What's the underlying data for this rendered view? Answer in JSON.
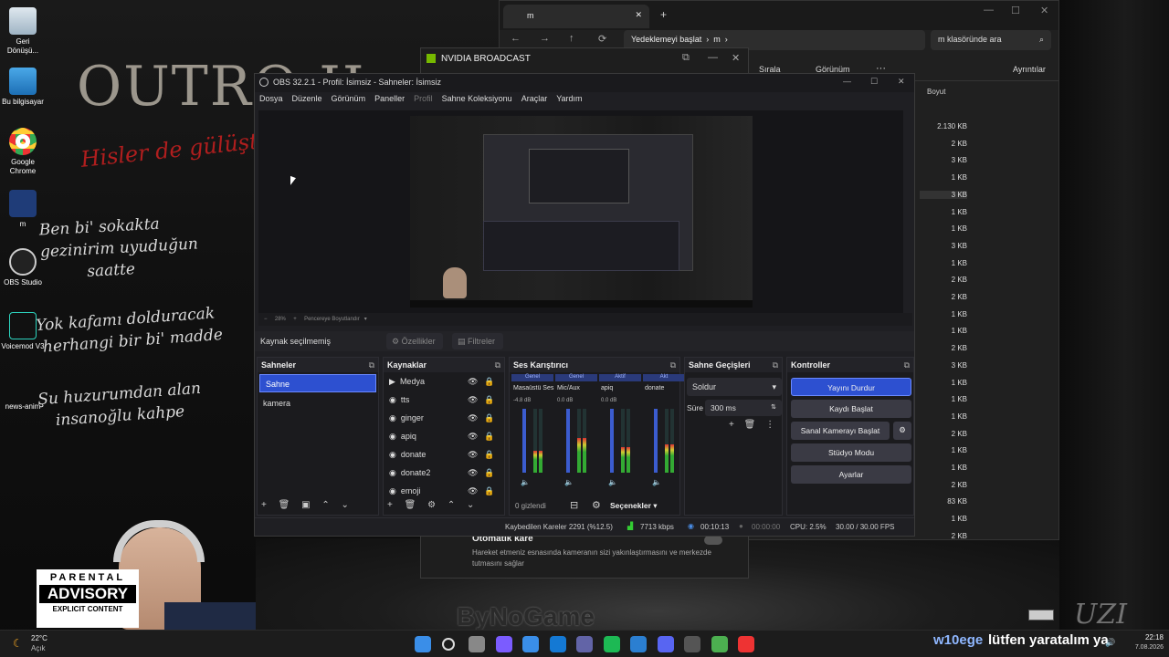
{
  "desktop": {
    "icons": [
      {
        "label": "Geri Dönüşü...",
        "icon": "recycle-bin-icon"
      },
      {
        "label": "Bu bilgisayar",
        "icon": "computer-icon"
      },
      {
        "label": "Google Chrome",
        "icon": "chrome-icon"
      },
      {
        "label": "m",
        "icon": "folder-icon"
      },
      {
        "label": "OBS Studio",
        "icon": "obs-icon"
      },
      {
        "label": "Voicemod V3",
        "icon": "voicemod-icon"
      },
      {
        "label": "news-anim",
        "icon": "file-icon"
      }
    ],
    "wallpaper_title": "OUTRO II",
    "wallpaper_red": "Hisler de gülüşte",
    "lyrics": [
      "Ben bi' sokakta",
      "gezinirim uyuduğun",
      "saatte",
      "Yok kafamı dolduracak",
      "herhangi bir bi' madde",
      "Şu huzurumdan alan",
      "insanoğlu kahpe"
    ],
    "advisory": [
      "PARENTAL",
      "ADVISORY",
      "EXPLICIT CONTENT"
    ],
    "signature": "UZI"
  },
  "explorer": {
    "tab": "m",
    "breadcrumb": [
      "Yedeklemeyi başlat",
      "m"
    ],
    "search_placeholder": "m klasöründe ara",
    "toolbar": [
      "Sırala",
      "Görünüm",
      "Ayrıntılar"
    ],
    "size_header": "Boyut",
    "sizes": [
      "2.130 KB",
      "2 KB",
      "3 KB",
      "1 KB",
      "3 KB",
      "1 KB",
      "1 KB",
      "3 KB",
      "1 KB",
      "2 KB",
      "2 KB",
      "1 KB",
      "1 KB",
      "2 KB",
      "3 KB",
      "1 KB",
      "1 KB",
      "1 KB",
      "2 KB",
      "1 KB",
      "1 KB",
      "2 KB",
      "83 KB",
      "1 KB",
      "2 KB"
    ]
  },
  "nvidia": {
    "title": "NVIDIA BROADCAST",
    "auto_frame_title": "Otomatik kare",
    "auto_frame_desc": "Hareket etmeniz esnasında kameranın sizi yakınlaştırmasını ve merkezde tutmasını sağlar"
  },
  "obs": {
    "title": "OBS 32.2.1 - Profil: İsimsiz - Sahneler: İsimsiz",
    "menu": [
      "Dosya",
      "Düzenle",
      "Görünüm",
      "Paneller",
      "Profil",
      "Sahne Koleksiyonu",
      "Araçlar",
      "Yardım"
    ],
    "zoom": "28%",
    "fit_label": "Pencereye Boyutlandır",
    "no_source": "Kaynak seçilmemiş",
    "properties": "Özellikler",
    "filters": "Filtreler",
    "scenes": {
      "title": "Sahneler",
      "items": [
        "Sahne",
        "kamera"
      ],
      "selected": 0
    },
    "sources": {
      "title": "Kaynaklar",
      "items": [
        "Medya",
        "tts",
        "ginger",
        "apiq",
        "donate",
        "donate2",
        "emoji"
      ]
    },
    "mixer": {
      "title": "Ses Karıştırıcı",
      "channels": [
        {
          "label": "Genel",
          "name": "Masaüstü Ses",
          "db": "-4.8 dB",
          "level": 0.35
        },
        {
          "label": "Genel",
          "name": "Mic/Aux",
          "db": "0.0 dB",
          "level": 0.55
        },
        {
          "label": "Aktif",
          "name": "apiq",
          "db": "0.0 dB",
          "level": 0.4
        },
        {
          "label": "Akt",
          "name": "donate",
          "db": "",
          "level": 0.45
        }
      ],
      "scale": [
        "0",
        "-6",
        "-12",
        "-18",
        "-24",
        "-30",
        "-36",
        "-42",
        "-48",
        "-54",
        "-60"
      ],
      "hidden": "0 gizlendi",
      "options": "Seçenekler"
    },
    "transitions": {
      "title": "Sahne Geçişleri",
      "type": "Soldur",
      "duration_label": "Süre",
      "duration": "300 ms"
    },
    "controls": {
      "title": "Kontroller",
      "buttons": [
        "Yayını Durdur",
        "Kaydı Başlat",
        "Sanal Kamerayı Başlat",
        "Stüdyo Modu",
        "Ayarlar"
      ]
    },
    "status": {
      "dropped": "Kaybedilen Kareler 2291 (%12.5)",
      "bitrate": "7713 kbps",
      "stream_time": "00:10:13",
      "rec_time": "00:00:00",
      "cpu": "CPU: 2.5%",
      "fps": "30.00 / 30.00 FPS"
    }
  },
  "taskbar": {
    "weather_temp": "22°C",
    "weather_desc": "Açık",
    "user": "w10ege",
    "marquee": "lütfen yaratalım ya",
    "time": "22:18",
    "date": "7.08.2026",
    "watermark": "ByNoGame",
    "apps": [
      "windows-icon",
      "search-icon",
      "taskview-icon",
      "copilot-icon",
      "store-icon",
      "outlook-icon",
      "teams-icon",
      "spotify-icon",
      "vscode-icon",
      "discord-icon",
      "obs-taskbar-icon",
      "media-icon",
      "chrome-taskbar-icon"
    ]
  }
}
